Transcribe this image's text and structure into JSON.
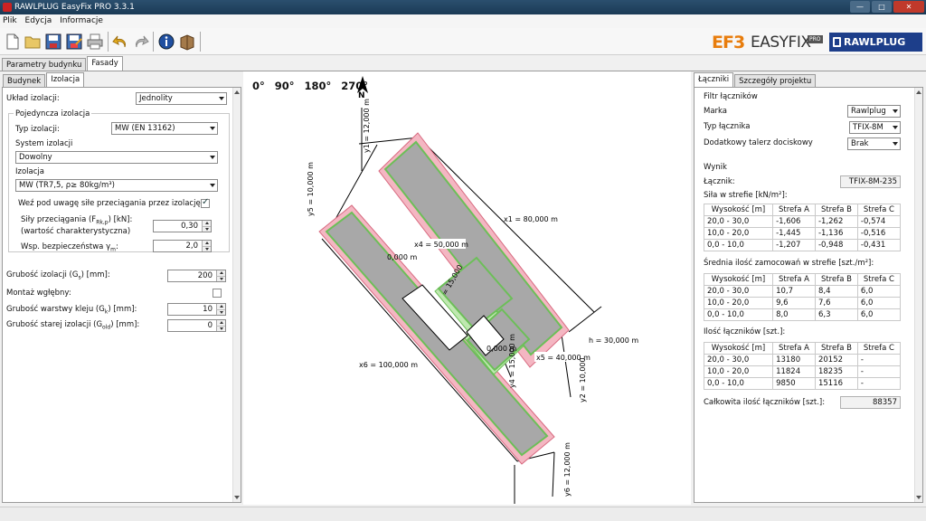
{
  "window": {
    "title": "RAWLPLUG EasyFix PRO 3.3.1"
  },
  "menu": [
    "Plik",
    "Edycja",
    "Informacje"
  ],
  "logos": {
    "ef3": "EF3",
    "easyfix": "EASYFIX",
    "pro": "PRO",
    "rawlplug": "RAWLPLUG"
  },
  "main_tabs": [
    "Parametry budynku",
    "Fasady"
  ],
  "sub_tabs": [
    "Budynek",
    "Izolacja"
  ],
  "left": {
    "uklad_label": "Układ izolacji:",
    "uklad_value": "Jednolity",
    "group_title": "Pojedyncza izolacja",
    "typ_label": "Typ izolacji:",
    "typ_value": "MW (EN 13162)",
    "system_label": "System izolacji",
    "system_value": "Dowolny",
    "izolacja_label": "Izolacja",
    "izolacja_value": "MW (TR7,5, ρ≥ 80kg/m³)",
    "przeciaganie_label": "Weź pod uwagę siłe przeciągania przez izolację",
    "sily_label": "Siły przeciągania (F",
    "sily_sub": "Rk,p",
    "sily_tail": ") [kN]:",
    "sily_note": "(wartość charakterystyczna)",
    "sily_value": "0,30",
    "wsp_label": "Wsp. bezpieczeństwa γ",
    "wsp_sub": "m",
    "wsp_tail": ":",
    "wsp_value": "2,0",
    "grubosc_label": "Grubość izolacji (G",
    "grubosc_sub": "s",
    "grubosc_tail": ") [mm]:",
    "grubosc_value": "200",
    "montaz_label": "Montaż wgłębny:",
    "klej_label": "Grubość warstwy kleju (G",
    "klej_sub": "k",
    "klej_tail": ") [mm]:",
    "klej_value": "10",
    "stara_label": "Grubość starej izolacji (G",
    "stara_sub": "old",
    "stara_tail": ") [mm]:",
    "stara_value": "0"
  },
  "drawing": {
    "angles": [
      "0°",
      "90°",
      "180°",
      "270°"
    ],
    "north": "N",
    "dims": {
      "y1": "y1 = 12,000 m",
      "y5": "y5 = 10,000 m",
      "x1": "x1 = 80,000 m",
      "x4": "x4 = 50,000 m",
      "y3a": "= 15,000",
      "y3b": "0,000 m",
      "h": "h = 30,000 m",
      "x6": "x6 = 100,000 m",
      "x5": "x5 = 40,000 m",
      "x2": "0,000 m",
      "y4": "y4 = 15,000 m",
      "y2": "y2 = 10,000",
      "y6": "y6 = 12,000 m"
    }
  },
  "right_tabs": [
    "Łączniki",
    "Szczegóły projektu"
  ],
  "right": {
    "filter_title": "Filtr łączników",
    "marka_label": "Marka",
    "marka_value": "Rawlplug",
    "typ_label": "Typ łącznika",
    "typ_value": "TFIX-8M",
    "talerz_label": "Dodatkowy talerz dociskowy",
    "talerz_value": "Brak",
    "wynik_title": "Wynik",
    "lacznik_label": "Łącznik:",
    "lacznik_value": "TFIX-8M-235",
    "sila_title": "Siła w strefie [kN/m²]:",
    "srednia_title": "Średnia ilość zamocowań w strefie [szt./m²]:",
    "ilosc_title": "Ilość łączników [szt.]:",
    "calkowita_label": "Całkowita ilość łączników [szt.]:",
    "calkowita_value": "88357",
    "headers": [
      "Wysokość [m]",
      "Strefa A",
      "Strefa B",
      "Strefa C"
    ],
    "sila_rows": [
      [
        "20,0 - 30,0",
        "-1,606",
        "-1,262",
        "-0,574"
      ],
      [
        "10,0 - 20,0",
        "-1,445",
        "-1,136",
        "-0,516"
      ],
      [
        "0,0 - 10,0",
        "-1,207",
        "-0,948",
        "-0,431"
      ]
    ],
    "srednia_rows": [
      [
        "20,0 - 30,0",
        "10,7",
        "8,4",
        "6,0"
      ],
      [
        "10,0 - 20,0",
        "9,6",
        "7,6",
        "6,0"
      ],
      [
        "0,0 - 10,0",
        "8,0",
        "6,3",
        "6,0"
      ]
    ],
    "ilosc_rows": [
      [
        "20,0 - 30,0",
        "13180",
        "20152",
        "-"
      ],
      [
        "10,0 - 20,0",
        "11824",
        "18235",
        "-"
      ],
      [
        "0,0 - 10,0",
        "9850",
        "15116",
        "-"
      ]
    ]
  }
}
